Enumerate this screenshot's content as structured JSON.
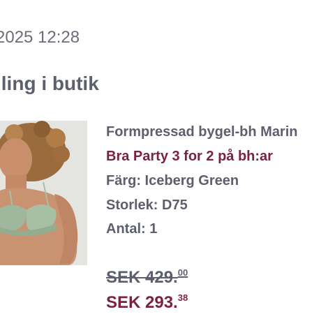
{
  "header": {
    "timestamp": "2025 12:28",
    "section_title": "lling i butik"
  },
  "product": {
    "image_icon": "product-photo-green-lace-bra",
    "name": "Formpressad bygel-bh Marin",
    "promo": "Bra Party 3 for 2 på bh:ar",
    "color_label": "Färg: Iceberg Green",
    "size_label": "Storlek: D75",
    "quantity_label": "Antal: 1",
    "original_price_main": "SEK 429.",
    "original_price_cents": "00",
    "sale_price_main": "SEK 293.",
    "sale_price_cents": "38"
  },
  "colors": {
    "text": "#5d5f6e",
    "accent": "#7c2143",
    "image_bg": "#e4e4e1"
  }
}
